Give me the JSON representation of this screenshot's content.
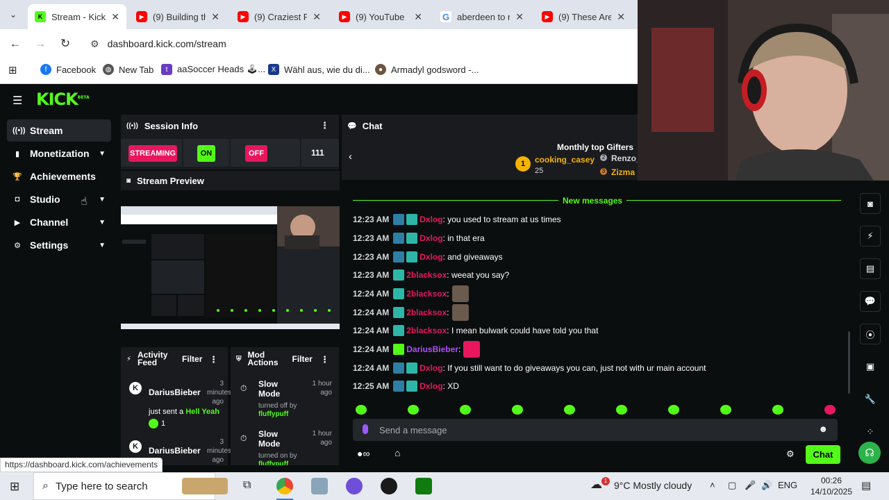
{
  "browser": {
    "tabs": [
      {
        "title": "Stream - Kick",
        "favicon": "kick-icon",
        "active": true
      },
      {
        "title": "(9) Building th",
        "favicon": "youtube-icon"
      },
      {
        "title": "(9) Craziest Po",
        "favicon": "youtube-icon"
      },
      {
        "title": "(9) YouTube",
        "favicon": "youtube-icon"
      },
      {
        "title": "aberdeen to n",
        "favicon": "google-icon"
      },
      {
        "title": "(9) These Are",
        "favicon": "youtube-icon"
      }
    ],
    "url": "dashboard.kick.com/stream",
    "bookmarks": [
      {
        "label": "Facebook",
        "color": "#1877f2"
      },
      {
        "label": "New Tab",
        "color": "#555555"
      },
      {
        "label": "aaSoccer Heads 🕹...",
        "color": "#6a3cc2"
      },
      {
        "label": "Wähl aus, wie du di...",
        "color": "#1a3a8a"
      },
      {
        "label": "Armadyl godsword -...",
        "color": "#6b5540"
      }
    ],
    "status_url": "https://dashboard.kick.com/achievements"
  },
  "kick": {
    "brand_color": "#53fc18",
    "logo_text": "KICK",
    "logo_beta": "BETA",
    "sidebar": [
      {
        "label": "Stream",
        "icon": "broadcast-icon",
        "active": true,
        "chevron": false
      },
      {
        "label": "Monetization",
        "icon": "dollar-icon",
        "chevron": true
      },
      {
        "label": "Achievements",
        "icon": "trophy-icon",
        "chevron": false
      },
      {
        "label": "Studio",
        "icon": "studio-icon",
        "chevron": true
      },
      {
        "label": "Channel",
        "icon": "channel-icon",
        "chevron": true
      },
      {
        "label": "Settings",
        "icon": "gear-icon",
        "chevron": true
      }
    ],
    "session_info": {
      "title": "Session Info",
      "streaming_label": "STREAMING",
      "on_label": "ON",
      "off_label": "OFF",
      "viewer_count": "111"
    },
    "stream_preview": {
      "title": "Stream Preview"
    },
    "activity_feed": {
      "title": "Activity Feed",
      "filter": "Filter",
      "items": [
        {
          "user": "DariusBieber",
          "ago": "3 minutes ago",
          "text": "just sent a",
          "highlight": "Hell Yeah",
          "count": "1"
        },
        {
          "user": "DariusBieber",
          "ago": "3 minutes ago"
        }
      ]
    },
    "mod_actions": {
      "title": "Mod Actions",
      "filter": "Filter",
      "items": [
        {
          "action": "Slow Mode",
          "detail": "turned off by",
          "by": "fluffypuff",
          "ago": "1 hour ago"
        },
        {
          "action": "Slow Mode",
          "detail": "turned on by",
          "by": "fluffypuff",
          "ago": "1 hour ago"
        }
      ]
    },
    "chat": {
      "title": "Chat",
      "gifters_title": "Monthly top Gifters",
      "gifters": [
        {
          "rank": "1",
          "name": "cooking_casey",
          "count": "25"
        },
        {
          "rank": "2",
          "name": "Renzo_"
        },
        {
          "rank": "3",
          "name": "Zizma"
        }
      ],
      "new_messages_label": "New messages",
      "messages": [
        {
          "time": "12:23 AM",
          "user": "Dxlog",
          "color": "#e8175d",
          "text": ": you used to stream at us times",
          "badges": [
            "sub",
            "og"
          ]
        },
        {
          "time": "12:23 AM",
          "user": "Dxlog",
          "color": "#e8175d",
          "text": ": in that era",
          "badges": [
            "sub",
            "og"
          ]
        },
        {
          "time": "12:23 AM",
          "user": "Dxlog",
          "color": "#e8175d",
          "text": ": and giveaways",
          "badges": [
            "sub",
            "og"
          ]
        },
        {
          "time": "12:23 AM",
          "user": "2blacksox",
          "color": "#e8175d",
          "text": ": weeat you say?",
          "badges": [
            "og"
          ]
        },
        {
          "time": "12:24 AM",
          "user": "2blacksox",
          "color": "#e8175d",
          "text": ":",
          "badges": [
            "og"
          ],
          "emote": true
        },
        {
          "time": "12:24 AM",
          "user": "2blacksox",
          "color": "#e8175d",
          "text": ":",
          "badges": [
            "og"
          ],
          "emote": true
        },
        {
          "time": "12:24 AM",
          "user": "2blacksox",
          "color": "#e8175d",
          "text": ": I mean bulwark could have told you that",
          "badges": [
            "og"
          ]
        },
        {
          "time": "12:24 AM",
          "user": "DariusBieber",
          "color": "#b04dff",
          "text": ":",
          "badges": [
            "gift"
          ],
          "emote": true
        },
        {
          "time": "12:24 AM",
          "user": "Dxlog",
          "color": "#e8175d",
          "text": ": If you still want to do giveaways you can, just not with ur main account",
          "badges": [
            "sub",
            "og"
          ]
        },
        {
          "time": "12:25 AM",
          "user": "Dxlog",
          "color": "#e8175d",
          "text": ": XD",
          "badges": [
            "sub",
            "og"
          ]
        }
      ],
      "input_placeholder": "Send a message",
      "send_label": "Chat"
    },
    "rail_icons": [
      "camera-icon",
      "lightning-icon",
      "notes-icon",
      "chat-icon",
      "broadcast-icon",
      "layout-icon",
      "wrench-icon",
      "dots-icon",
      "support-icon"
    ]
  },
  "taskbar": {
    "search_placeholder": "Type here to search",
    "weather": "9°C  Mostly cloudy",
    "language": "ENG",
    "time": "00:26",
    "date": "14/10/2025",
    "weather_badge": "1"
  }
}
